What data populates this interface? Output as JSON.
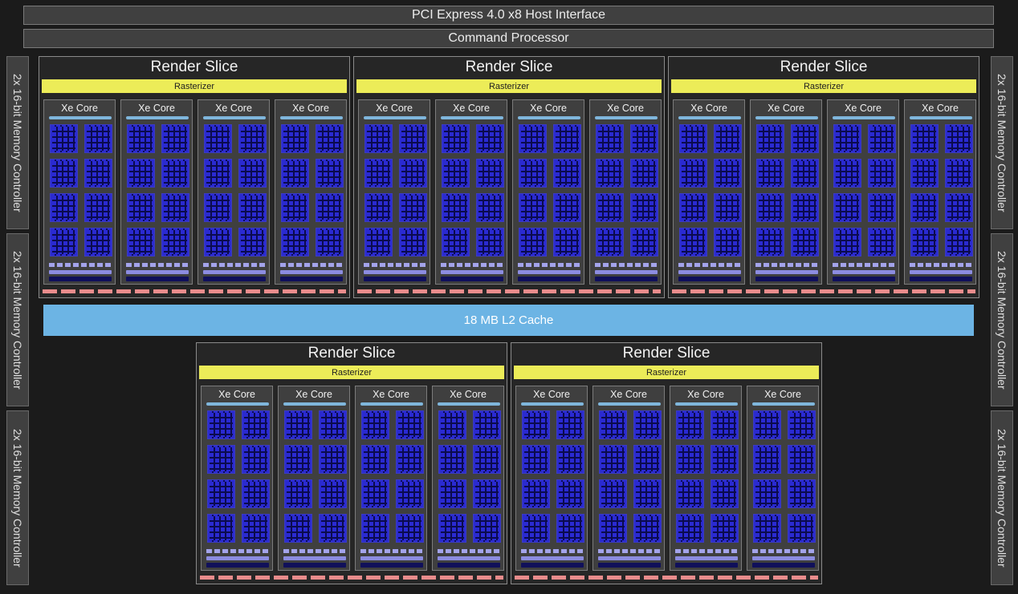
{
  "host_interface": "PCI Express 4.0 x8 Host Interface",
  "command_processor": "Command Processor",
  "l2_cache": "18 MB L2 Cache",
  "memory_controllers": {
    "left": [
      "2x 16-bit Memory Controller",
      "2x 16-bit Memory Controller",
      "2x 16-bit Memory Controller"
    ],
    "right": [
      "2x 16-bit Memory Controller",
      "2x 16-bit Memory Controller",
      "2x 16-bit Memory Controller"
    ]
  },
  "render_slices": [
    {
      "title": "Render Slice",
      "rasterizer": "Rasterizer",
      "cores": [
        "Xe Core",
        "Xe Core",
        "Xe Core",
        "Xe Core"
      ]
    },
    {
      "title": "Render Slice",
      "rasterizer": "Rasterizer",
      "cores": [
        "Xe Core",
        "Xe Core",
        "Xe Core",
        "Xe Core"
      ]
    },
    {
      "title": "Render Slice",
      "rasterizer": "Rasterizer",
      "cores": [
        "Xe Core",
        "Xe Core",
        "Xe Core",
        "Xe Core"
      ]
    },
    {
      "title": "Render Slice",
      "rasterizer": "Rasterizer",
      "cores": [
        "Xe Core",
        "Xe Core",
        "Xe Core",
        "Xe Core"
      ]
    },
    {
      "title": "Render Slice",
      "rasterizer": "Rasterizer",
      "cores": [
        "Xe Core",
        "Xe Core",
        "Xe Core",
        "Xe Core"
      ]
    }
  ],
  "colors": {
    "background": "#1b1b1b",
    "block": "#404040",
    "rasterizer": "#ecec58",
    "l2_cache": "#6cb4e4",
    "vector_engine": "#2a2ad2",
    "memory_strip": "#e98c8c"
  }
}
